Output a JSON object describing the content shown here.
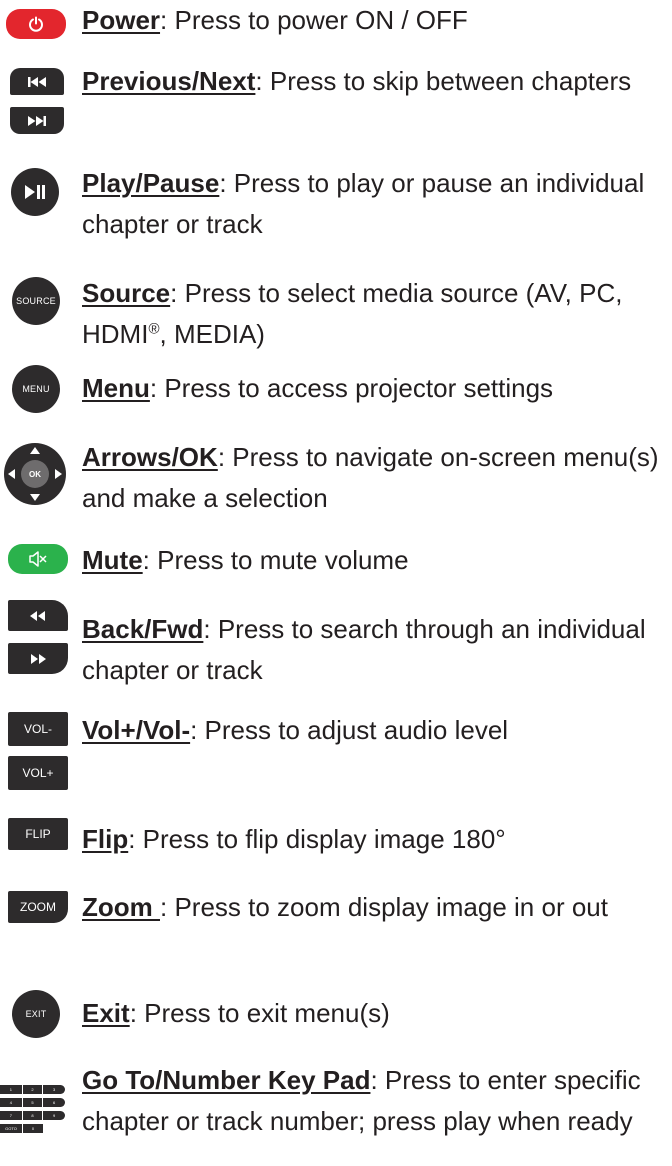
{
  "entries": [
    {
      "id": "power",
      "term": "Power",
      "desc": ": Press to power ON / OFF"
    },
    {
      "id": "previous-next",
      "term": "Previous/Next",
      "desc": ": Press to skip between chapters"
    },
    {
      "id": "play-pause",
      "term": "Play/Pause",
      "desc": ": Press to play or pause an individual chapter or track"
    },
    {
      "id": "source",
      "term": "Source",
      "desc": ": Press to select media source (AV, PC, HDMI",
      "desc_sup": "®",
      "desc_tail": ", MEDIA)"
    },
    {
      "id": "menu",
      "term": "Menu",
      "desc": ": Press to access projector settings"
    },
    {
      "id": "arrows-ok",
      "term": "Arrows/OK",
      "desc": ": Press to navigate on-screen menu(s) and make a selection"
    },
    {
      "id": "mute",
      "term": "Mute",
      "desc": ": Press to mute volume"
    },
    {
      "id": "back-fwd",
      "term": "Back/Fwd",
      "desc": ": Press to search through an individual chapter or track"
    },
    {
      "id": "vol",
      "term": "Vol+/Vol-",
      "desc": ": Press to adjust audio level"
    },
    {
      "id": "flip",
      "term": "Flip",
      "desc": ": Press to flip display image 180°"
    },
    {
      "id": "zoom",
      "term": "Zoom ",
      "desc": ": Press to zoom display image in or out"
    },
    {
      "id": "exit",
      "term": "Exit",
      "desc": ": Press to exit menu(s)"
    },
    {
      "id": "goto-keypad",
      "term": "Go To/Number Key Pad",
      "desc": ": Press to enter specific chapter or track number; press play when ready"
    }
  ],
  "icons": {
    "source_label": "SOURCE",
    "menu_label": "MENU",
    "ok_label": "OK",
    "vol_minus_label": "VOL-",
    "vol_plus_label": "VOL+",
    "flip_label": "FLIP",
    "zoom_label": "ZOOM",
    "exit_label": "EXIT",
    "keypad_rows": [
      [
        "1",
        "2",
        "3"
      ],
      [
        "4",
        "5",
        "6"
      ],
      [
        "7",
        "8",
        "9"
      ],
      [
        "GOTO",
        "0"
      ]
    ]
  },
  "colors": {
    "power": "#e3262d",
    "mute": "#2bb24c",
    "button_dark": "#2d2b2c",
    "text": "#231f20"
  }
}
